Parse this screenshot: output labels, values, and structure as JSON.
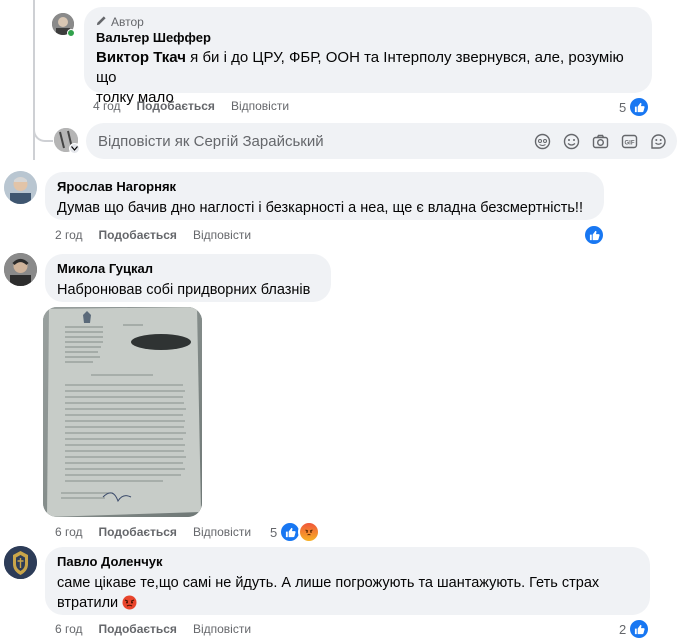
{
  "comment1": {
    "badge": "Автор",
    "author": "Вальтер Шеффер",
    "mention": "Виктор Ткач",
    "text_line1": " я би і до ЦРУ, ФБР, ООН та Інтерполу звернувся, але, розумію що",
    "text_line2": "толку мало",
    "time": "4 год",
    "like": "Подобається",
    "reply": "Відповісти",
    "reaction_count": "5"
  },
  "reply_box": {
    "placeholder": "Відповісти як Сергій Зарайський",
    "icons": [
      "avatar-sticker-icon",
      "emoji-icon",
      "camera-icon",
      "gif-icon",
      "sticker-icon"
    ]
  },
  "comment2": {
    "author": "Ярослав Нагорняк",
    "text": "Думав що бачив дно наглості і безкарності а неа, ще є владна безсмертність!!",
    "time": "2 год",
    "like": "Подобається",
    "reply": "Відповісти"
  },
  "comment3": {
    "author": "Микола Гуцкал",
    "text": "Набронював собі придворних блазнів",
    "time": "6 год",
    "like": "Подобається",
    "reply": "Відповісти",
    "reaction_count": "5"
  },
  "comment4": {
    "author": "Павло Доленчук",
    "text_line1": "саме цікаве те,що самі не йдуть. А лише погрожують та шантажують. Геть страх",
    "text_line2": "втратили",
    "time": "6 год",
    "like": "Подобається",
    "reply": "Відповісти",
    "reaction_count": "2"
  },
  "colors": {
    "like_blue": "#1877f2",
    "bubble_bg": "#f0f2f5",
    "meta_gray": "#65676b"
  }
}
